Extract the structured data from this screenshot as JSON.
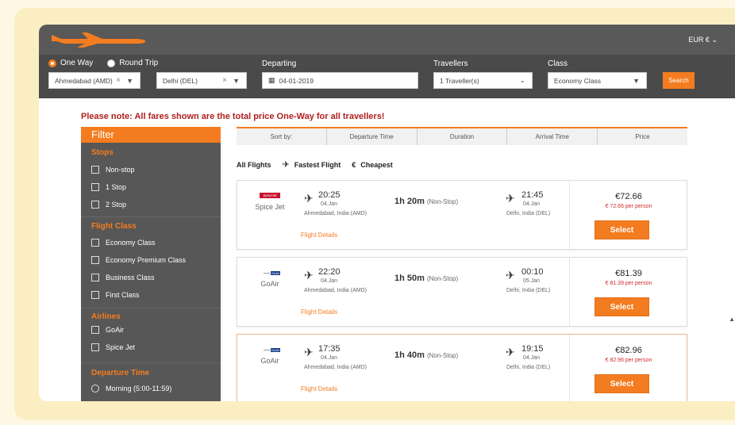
{
  "header": {
    "currency": "EUR €"
  },
  "search": {
    "trip_types": [
      {
        "label": "One Way",
        "selected": true
      },
      {
        "label": "Round Trip",
        "selected": false
      }
    ],
    "from": "Ahmedabad (AMD)",
    "to": "Delhi (DEL)",
    "departing_label": "Departing",
    "departing_value": "04-01-2019",
    "travellers_label": "Travellers",
    "travellers_value": "1 Traveller(s)",
    "class_label": "Class",
    "class_value": "Economy Class",
    "search_label": "Search"
  },
  "notice": "Please note: All fares shown are the total price One-Way for all travellers!",
  "filter": {
    "title": "Filter",
    "stops_title": "Stops",
    "stops": [
      "Non-stop",
      "1 Stop",
      "2 Stop"
    ],
    "class_title": "Flight Class",
    "classes": [
      "Economy Class",
      "Economy Premium Class",
      "Business Class",
      "First Class"
    ],
    "airlines_title": "Airlines",
    "airlines": [
      "GoAir",
      "Spice Jet"
    ],
    "departure_title": "Departure Time",
    "departure_times": [
      "Morning (5:00-11:59)"
    ]
  },
  "sort": {
    "label": "Sort by:",
    "options": [
      "Departure Time",
      "Duration",
      "Arrival Time",
      "Price"
    ]
  },
  "quick_filters": {
    "all": "All Flights",
    "fastest": "Fastest Flight",
    "cheapest": "Cheapest",
    "cheapest_symbol": "€"
  },
  "flights": [
    {
      "airline": "Spice Jet",
      "logo_text": "SpiceJet",
      "dep_time": "20:25",
      "dep_date": "04.Jan",
      "dep_place": "Ahmedabad, India (AMD)",
      "duration": "1h 20m",
      "stops": "(Non-Stop)",
      "arr_time": "21:45",
      "arr_date": "04.Jan",
      "arr_place": "Delhi, India (DEL)",
      "price": "€72.66",
      "per_person": "€ 72.66 per person",
      "details": "Flight Details",
      "select": "Select"
    },
    {
      "airline": "GoAir",
      "logo_text": "GoAir",
      "dep_time": "22:20",
      "dep_date": "04.Jan",
      "dep_place": "Ahmedabad, India (AMD)",
      "duration": "1h 50m",
      "stops": "(Non-Stop)",
      "arr_time": "00:10",
      "arr_date": "05.Jan",
      "arr_place": "Delhi, India (DEL)",
      "price": "€81.39",
      "per_person": "€ 81.39 per person",
      "details": "Flight Details",
      "select": "Select"
    },
    {
      "airline": "GoAir",
      "logo_text": "GoAir",
      "dep_time": "17:35",
      "dep_date": "04.Jan",
      "dep_place": "Ahmedabad, India (AMD)",
      "duration": "1h 40m",
      "stops": "(Non-Stop)",
      "arr_time": "19:15",
      "arr_date": "04.Jan",
      "arr_place": "Delhi, India (DEL)",
      "price": "€82.96",
      "per_person": "€ 82.96 per person",
      "details": "Flight Details",
      "select": "Select"
    }
  ],
  "colors": {
    "accent": "#f47c20",
    "topbar": "#595959",
    "notice": "#b0201f"
  }
}
